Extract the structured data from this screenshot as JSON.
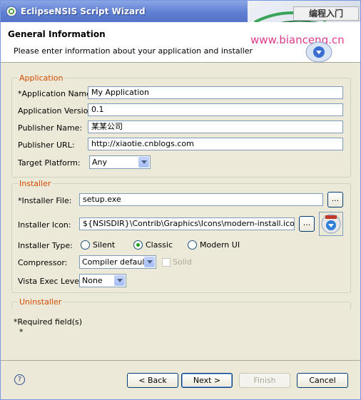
{
  "window": {
    "title": "EclipseNSIS Script Wizard"
  },
  "watermark": {
    "cn": "编程入门",
    "url": "www.bianceng.cn"
  },
  "header": {
    "title": "General Information",
    "description": "Please enter information about your application and installer"
  },
  "application": {
    "group_label": "Application",
    "name_label": "*Application Name:",
    "name_value": "My Application",
    "version_label": "Application Version:",
    "version_value": "0.1",
    "publisher_label": "Publisher Name:",
    "publisher_value": "某某公司",
    "url_label": "Publisher URL:",
    "url_value": "http://xiaotie.cnblogs.com",
    "platform_label": "Target Platform:",
    "platform_value": "Any"
  },
  "installer": {
    "group_label": "Installer",
    "file_label": "*Installer File:",
    "file_value": "setup.exe",
    "icon_label": "Installer Icon:",
    "icon_value": "${NSISDIR}\\Contrib\\Graphics\\Icons\\modern-install.ico",
    "browse_label": "...",
    "type_label": "Installer Type:",
    "type_options": [
      "Silent",
      "Classic",
      "Modern UI"
    ],
    "type_selected": "Classic",
    "compressor_label": "Compressor:",
    "compressor_value": "Compiler default",
    "solid_label": "Solid",
    "vista_label": "Vista Exec Level:",
    "vista_value": "None"
  },
  "uninstaller": {
    "group_label": "Uninstaller"
  },
  "footer": {
    "required_note": "*Required field(s)",
    "required_star": "*",
    "help_label": "?",
    "back_label": "< Back",
    "next_label": "Next >",
    "finish_label": "Finish",
    "cancel_label": "Cancel"
  }
}
